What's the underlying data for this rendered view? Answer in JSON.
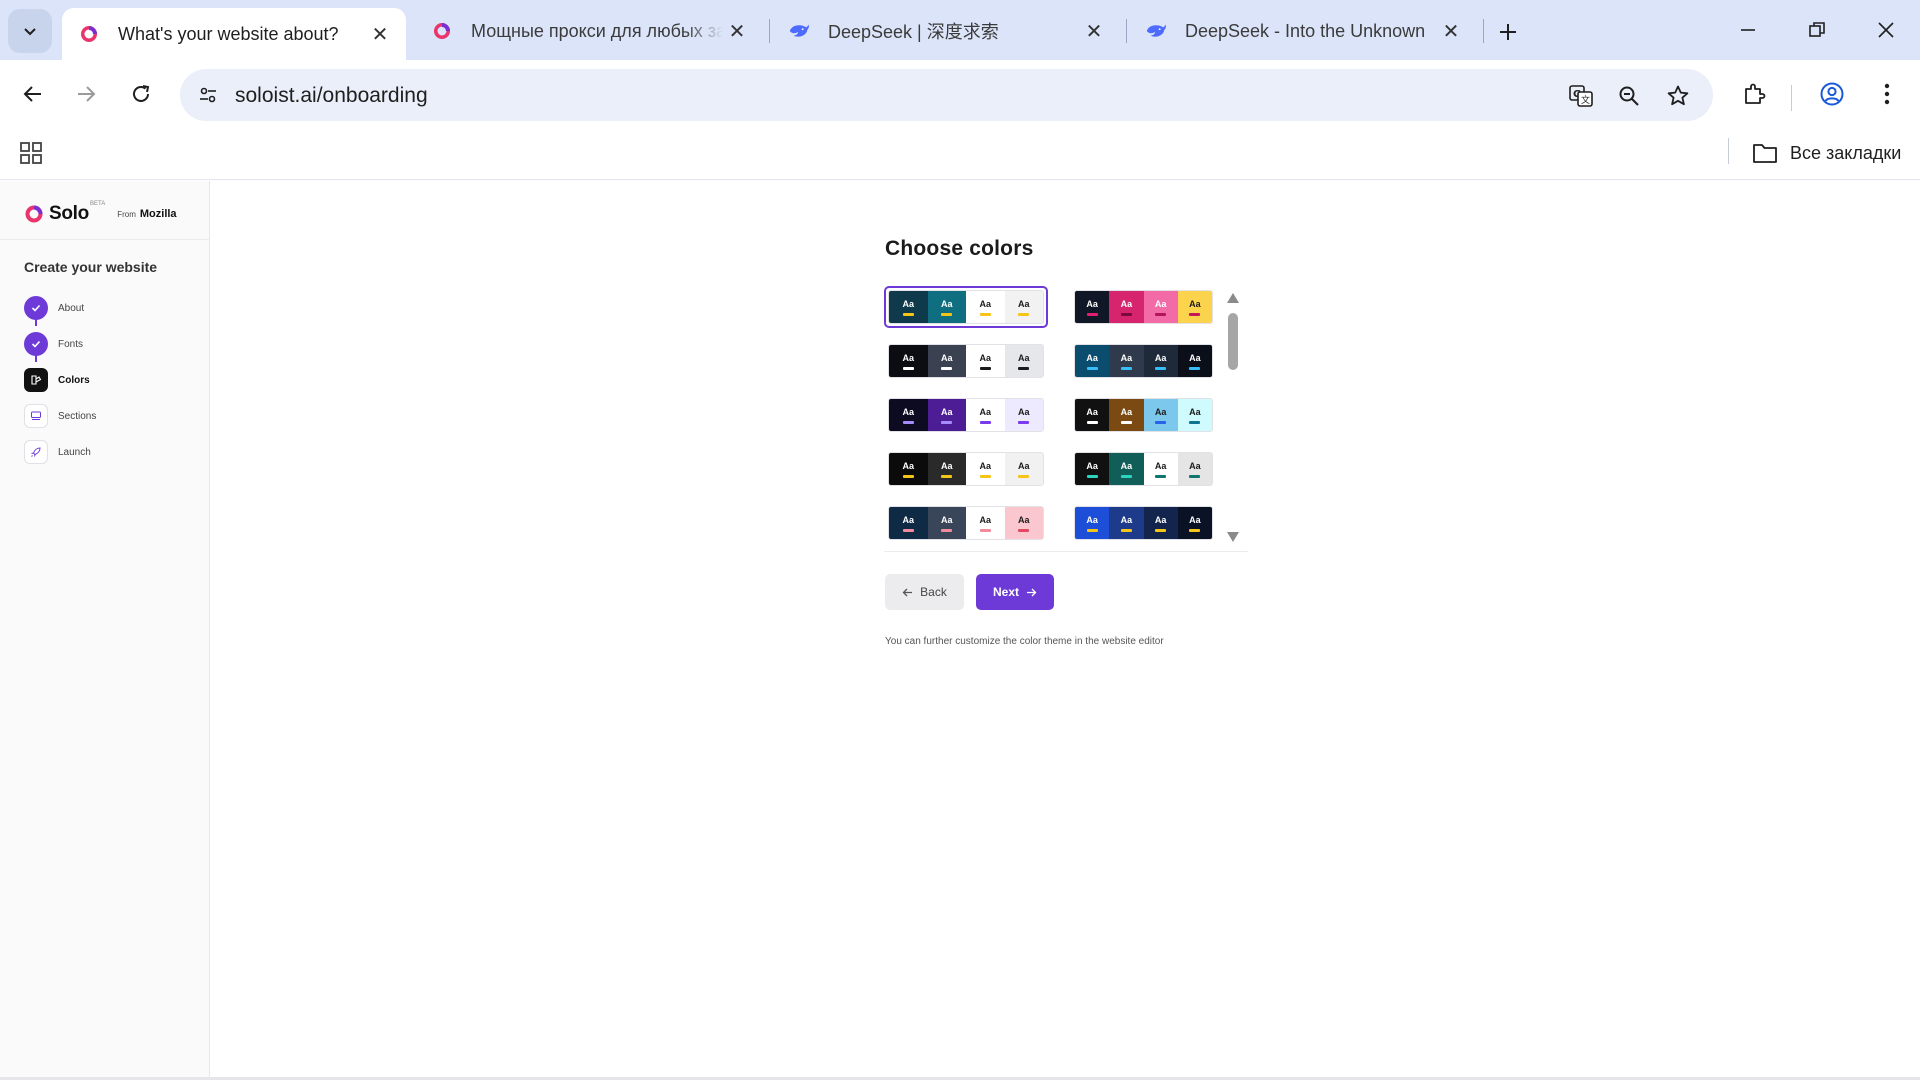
{
  "browser": {
    "tabs": [
      {
        "title": "What's your website about?",
        "icon": "solo-favicon",
        "active": true
      },
      {
        "title": "Мощные прокси для любых за",
        "icon": "solo-favicon",
        "active": false
      },
      {
        "title": "DeepSeek | 深度求索",
        "icon": "deepseek-whale-icon",
        "active": false
      },
      {
        "title": "DeepSeek - Into the Unknown",
        "icon": "deepseek-whale-icon",
        "active": false
      }
    ],
    "address": "soloist.ai/onboarding",
    "all_bookmarks_label": "Все закладки"
  },
  "sidebar": {
    "brand": "Solo",
    "beta": "BETA",
    "from": "From",
    "mozilla": "Mozilla",
    "heading": "Create your website",
    "steps": [
      {
        "label": "About",
        "state": "done"
      },
      {
        "label": "Fonts",
        "state": "done"
      },
      {
        "label": "Colors",
        "state": "current"
      },
      {
        "label": "Sections",
        "state": "todo"
      },
      {
        "label": "Launch",
        "state": "todo"
      }
    ]
  },
  "main": {
    "title": "Choose colors",
    "swatch_text": "Aa",
    "palettes": [
      {
        "selected": true,
        "swatches": [
          {
            "bg": "#0f3a4b",
            "fg": "#ffffff",
            "bar": "#f5c518"
          },
          {
            "bg": "#0f6e80",
            "fg": "#ffffff",
            "bar": "#f5c518"
          },
          {
            "bg": "#ffffff",
            "fg": "#1b1b1b",
            "bar": "#f5c518"
          },
          {
            "bg": "#f2f2f2",
            "fg": "#1b1b1b",
            "bar": "#f5c518"
          }
        ]
      },
      {
        "selected": false,
        "swatches": [
          {
            "bg": "#101828",
            "fg": "#ffffff",
            "bar": "#e11d74"
          },
          {
            "bg": "#d6246e",
            "fg": "#ffffff",
            "bar": "#7a0a3b"
          },
          {
            "bg": "#f26aa6",
            "fg": "#ffffff",
            "bar": "#b3155d"
          },
          {
            "bg": "#fcd34d",
            "fg": "#1b1b1b",
            "bar": "#c2185b"
          }
        ]
      },
      {
        "selected": false,
        "swatches": [
          {
            "bg": "#0b0d12",
            "fg": "#ffffff",
            "bar": "#ffffff"
          },
          {
            "bg": "#3a4150",
            "fg": "#ffffff",
            "bar": "#ffffff"
          },
          {
            "bg": "#ffffff",
            "fg": "#1b1b1b",
            "bar": "#1b1b1b"
          },
          {
            "bg": "#e5e7eb",
            "fg": "#1b1b1b",
            "bar": "#1b1b1b"
          }
        ]
      },
      {
        "selected": false,
        "swatches": [
          {
            "bg": "#0b4d6e",
            "fg": "#ffffff",
            "bar": "#38bdf8"
          },
          {
            "bg": "#2f3a4c",
            "fg": "#ffffff",
            "bar": "#38bdf8"
          },
          {
            "bg": "#1e2a3a",
            "fg": "#ffffff",
            "bar": "#38bdf8"
          },
          {
            "bg": "#0b0f1a",
            "fg": "#ffffff",
            "bar": "#38bdf8"
          }
        ]
      },
      {
        "selected": false,
        "swatches": [
          {
            "bg": "#0d0b22",
            "fg": "#ffffff",
            "bar": "#a78bfa"
          },
          {
            "bg": "#4c1d95",
            "fg": "#ffffff",
            "bar": "#a78bfa"
          },
          {
            "bg": "#ffffff",
            "fg": "#1b1b1b",
            "bar": "#7c3aed"
          },
          {
            "bg": "#ede9fe",
            "fg": "#1b1b1b",
            "bar": "#7c3aed"
          }
        ]
      },
      {
        "selected": false,
        "swatches": [
          {
            "bg": "#111111",
            "fg": "#ffffff",
            "bar": "#ffffff"
          },
          {
            "bg": "#7a4a12",
            "fg": "#ffffff",
            "bar": "#ffffff"
          },
          {
            "bg": "#7cc8ec",
            "fg": "#1b1b1b",
            "bar": "#2563eb"
          },
          {
            "bg": "#cffafe",
            "fg": "#1b1b1b",
            "bar": "#0e7490"
          }
        ]
      },
      {
        "selected": false,
        "swatches": [
          {
            "bg": "#0b0b0b",
            "fg": "#ffffff",
            "bar": "#f5c518"
          },
          {
            "bg": "#2a2a2a",
            "fg": "#ffffff",
            "bar": "#f5c518"
          },
          {
            "bg": "#ffffff",
            "fg": "#1b1b1b",
            "bar": "#f5c518"
          },
          {
            "bg": "#f1f1f1",
            "fg": "#1b1b1b",
            "bar": "#f5c518"
          }
        ]
      },
      {
        "selected": false,
        "swatches": [
          {
            "bg": "#111111",
            "fg": "#ffffff",
            "bar": "#2dd4bf"
          },
          {
            "bg": "#115e59",
            "fg": "#ffffff",
            "bar": "#2dd4bf"
          },
          {
            "bg": "#ffffff",
            "fg": "#1b1b1b",
            "bar": "#0f766e"
          },
          {
            "bg": "#e5e5e5",
            "fg": "#1b1b1b",
            "bar": "#0f766e"
          }
        ]
      },
      {
        "selected": false,
        "swatches": [
          {
            "bg": "#0f2a44",
            "fg": "#ffffff",
            "bar": "#f28b9b"
          },
          {
            "bg": "#394558",
            "fg": "#ffffff",
            "bar": "#f28b9b"
          },
          {
            "bg": "#ffffff",
            "fg": "#1b1b1b",
            "bar": "#f28b9b"
          },
          {
            "bg": "#fbc7cf",
            "fg": "#1b1b1b",
            "bar": "#e24a62"
          }
        ]
      },
      {
        "selected": false,
        "swatches": [
          {
            "bg": "#1d4ed8",
            "fg": "#ffffff",
            "bar": "#f5c518"
          },
          {
            "bg": "#1e3a8a",
            "fg": "#ffffff",
            "bar": "#f5c518"
          },
          {
            "bg": "#13254d",
            "fg": "#ffffff",
            "bar": "#f5c518"
          },
          {
            "bg": "#0a1226",
            "fg": "#ffffff",
            "bar": "#f5c518"
          }
        ]
      }
    ],
    "back_label": "Back",
    "next_label": "Next",
    "hint": "You can further customize the color theme in the website editor",
    "accent": "#6d3ad8"
  }
}
